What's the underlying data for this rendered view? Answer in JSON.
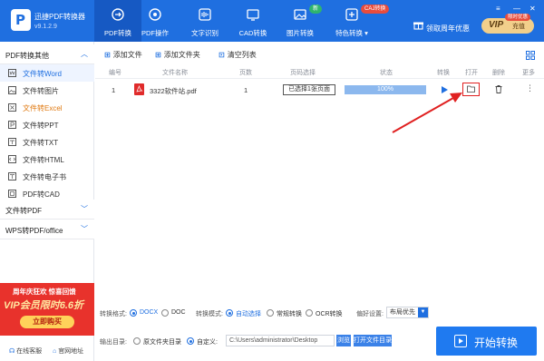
{
  "app": {
    "name": "迅捷PDF转换器",
    "version": "v9.1.2.9"
  },
  "nav": [
    {
      "label": "PDF转换",
      "icon": "pdf-convert-icon"
    },
    {
      "label": "PDF操作",
      "icon": "pdf-operate-icon"
    },
    {
      "label": "文字识别",
      "icon": "ocr-icon"
    },
    {
      "label": "CAD转换",
      "icon": "cad-icon"
    },
    {
      "label": "图片转换",
      "icon": "image-icon"
    },
    {
      "label": "特色转换 ▾",
      "icon": "special-icon"
    }
  ],
  "badges": {
    "new": "新",
    "caj": "CAJ转换"
  },
  "header": {
    "gift_label": "领取周年优惠",
    "vip_text": "VIP",
    "vip_action": "充值",
    "vip_pill": "限时优惠"
  },
  "sidebar": {
    "group1": "PDF转换其他",
    "items": [
      {
        "label": "文件转Word"
      },
      {
        "label": "文件转图片"
      },
      {
        "label": "文件转Excel"
      },
      {
        "label": "文件转PPT"
      },
      {
        "label": "文件转TXT"
      },
      {
        "label": "文件转HTML"
      },
      {
        "label": "文件转电子书"
      },
      {
        "label": "PDF转CAD"
      }
    ],
    "group2": "文件转PDF",
    "group3": "WPS转PDF/office",
    "promo": {
      "line1": "周年庆狂欢 惊喜回馈",
      "line2": "VIP会员限时6.6折",
      "button": "立即购买"
    },
    "footer": {
      "service": "在线客服",
      "website": "官网地址"
    }
  },
  "toolbar": {
    "add_file": "添加文件",
    "add_folder": "添加文件夹",
    "clear_list": "清空列表"
  },
  "table": {
    "headers": [
      "编号",
      "文件名称",
      "页数",
      "页码选择",
      "状态",
      "转换",
      "打开",
      "删除",
      "更多"
    ],
    "rows": [
      {
        "index": "1",
        "filename": "3322软件站.pdf",
        "pages": "1",
        "page_select": "已选择1张页面",
        "progress": 100,
        "progress_label": "100%"
      }
    ]
  },
  "settings": {
    "mode_label": "转换格式:",
    "mode_docx": "DOCX",
    "mode_doc": "DOC",
    "conv_label": "转换模式:",
    "conv_auto": "自动选择",
    "conv_normal": "常规转换",
    "conv_ocr": "OCR转换",
    "layout_label": "偏好设置:",
    "layout_value": "布局优先"
  },
  "output": {
    "label": "输出目录:",
    "opt_source": "原文件夹目录",
    "opt_custom": "自定义:",
    "path": "C:\\Users\\administrator\\Desktop",
    "browse": "浏览",
    "open_folder": "打开文件目录"
  },
  "start_button": "开始转换",
  "colors": {
    "primary": "#1f6fe0",
    "accent_red": "#e02020",
    "promo_red": "#e8322c"
  }
}
